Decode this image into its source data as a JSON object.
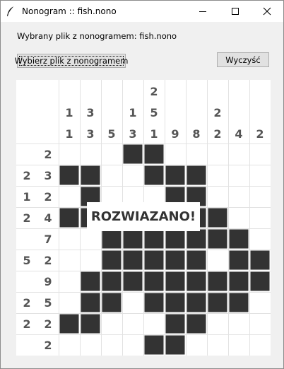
{
  "window": {
    "title": "Nonogram :: fish.nono",
    "icon": "feather-icon",
    "controls": [
      "minimize-icon",
      "maximize-icon",
      "close-icon"
    ]
  },
  "file_label": "Wybrany plik z nonogramem: fish.nono",
  "buttons": {
    "choose_file": "Wybierz plik z nonogramem",
    "clear": "Wyczyść"
  },
  "puzzle": {
    "column_clues": [
      [
        "1",
        "1"
      ],
      [
        "3",
        "3"
      ],
      [
        "5"
      ],
      [
        "1",
        "3"
      ],
      [
        "2",
        "5",
        "1"
      ],
      [
        "9"
      ],
      [
        "8"
      ],
      [
        "2",
        "2"
      ],
      [
        "4"
      ],
      [
        "2"
      ]
    ],
    "row_clues": [
      [
        "2"
      ],
      [
        "2",
        "3"
      ],
      [
        "1",
        "2"
      ],
      [
        "2",
        "4"
      ],
      [
        "7"
      ],
      [
        "5",
        "2"
      ],
      [
        "9"
      ],
      [
        "2",
        "5"
      ],
      [
        "2",
        "2"
      ],
      [
        "2"
      ]
    ],
    "grid": [
      "...##.....",
      "##..###...",
      ".#...##...",
      "##..####..",
      "..#######.",
      "..#####.##",
      ".#########",
      ".##.#####.",
      "##...##...",
      "....##...."
    ],
    "status": "ROZWIAZANO!"
  },
  "colors": {
    "filled": "#333333",
    "clue": "#555555",
    "grid_line": "#e2e2e2",
    "window_bg": "#f0f0f0"
  }
}
